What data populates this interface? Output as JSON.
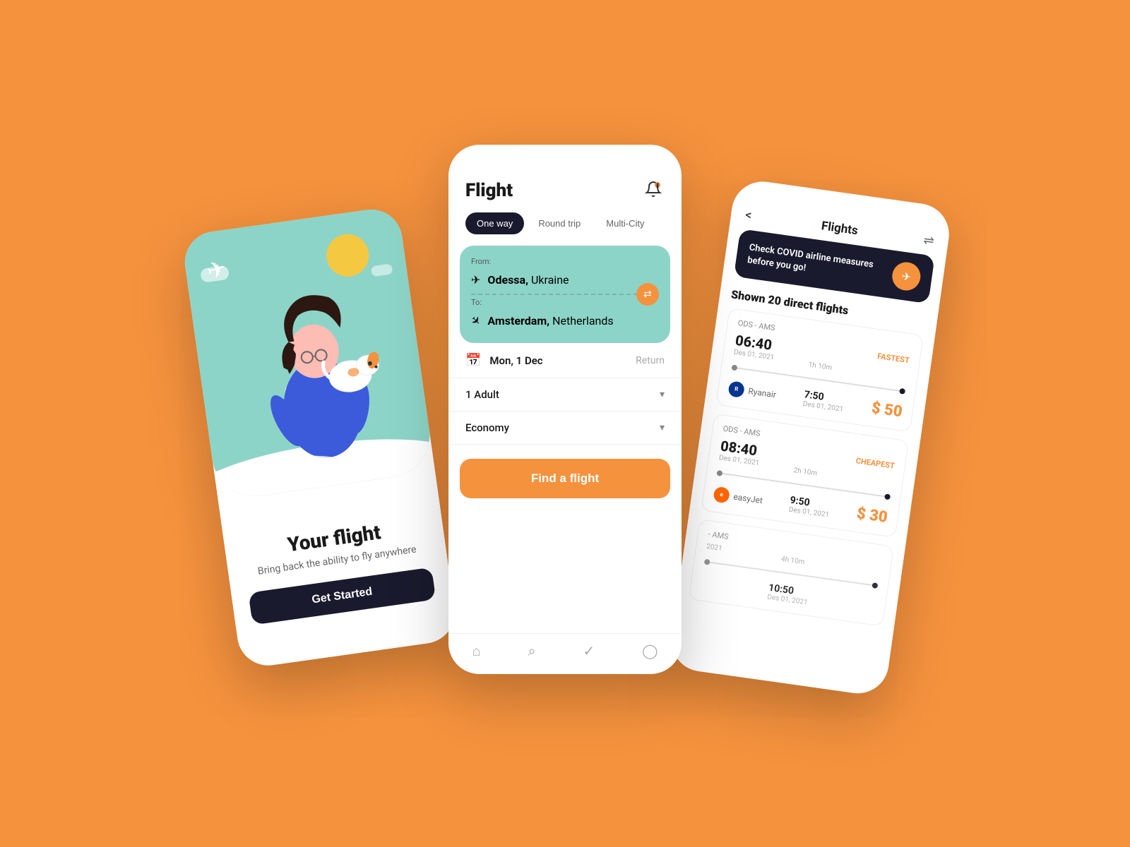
{
  "background": "#F5923E",
  "phone1": {
    "title": "Your flight",
    "subtitle": "Bring back the ability to fly anywhere",
    "cta": "Get Started",
    "hero_bg": "#8DD4C8"
  },
  "phone2": {
    "title": "Flight",
    "tabs": [
      "One way",
      "Round trip",
      "Multi-City"
    ],
    "active_tab": "One way",
    "from_label": "From:",
    "from_city": "Odessa,",
    "from_country": " Ukraine",
    "to_label": "To:",
    "to_city": "Amsterdam,",
    "to_country": " Netherlands",
    "date": "Mon, 1 Dec",
    "return_label": "Return",
    "passengers": "1 Adult",
    "cabin": "Economy",
    "cta": "Find a flight",
    "nav_icons": [
      "home",
      "search",
      "check",
      "user"
    ]
  },
  "phone3": {
    "title": "Flights",
    "back": "<",
    "covid_text": "Check COVID airline measures before you go!",
    "flights_count": "Shown 20 direct flights",
    "route1": "ODS - AMS",
    "flight1_depart": "06:40",
    "flight1_date": "Des 01, 2021",
    "flight1_duration": "1h 10m",
    "flight1_arrive": "7:50",
    "flight1_arrive_date": "Des 01, 2021",
    "flight1_badge": "FASTEST",
    "flight1_airline": "Ryanair",
    "flight1_price": "$ 50",
    "route2": "ODS - AMS",
    "flight2_depart": "08:40",
    "flight2_date": "Des 01, 2021",
    "flight2_duration": "2h 10m",
    "flight2_arrive": "9:50",
    "flight2_arrive_date": "Des 01, 2021",
    "flight2_badge": "CHEAPEST",
    "flight2_airline": "easyJet",
    "flight2_price": "$ 30",
    "route3": "- AMS",
    "flight3_depart": "",
    "flight3_date": "2021",
    "flight3_duration": "4h 10m",
    "flight3_arrive": "10:50",
    "flight3_arrive_date": "Des 01, 2021"
  }
}
